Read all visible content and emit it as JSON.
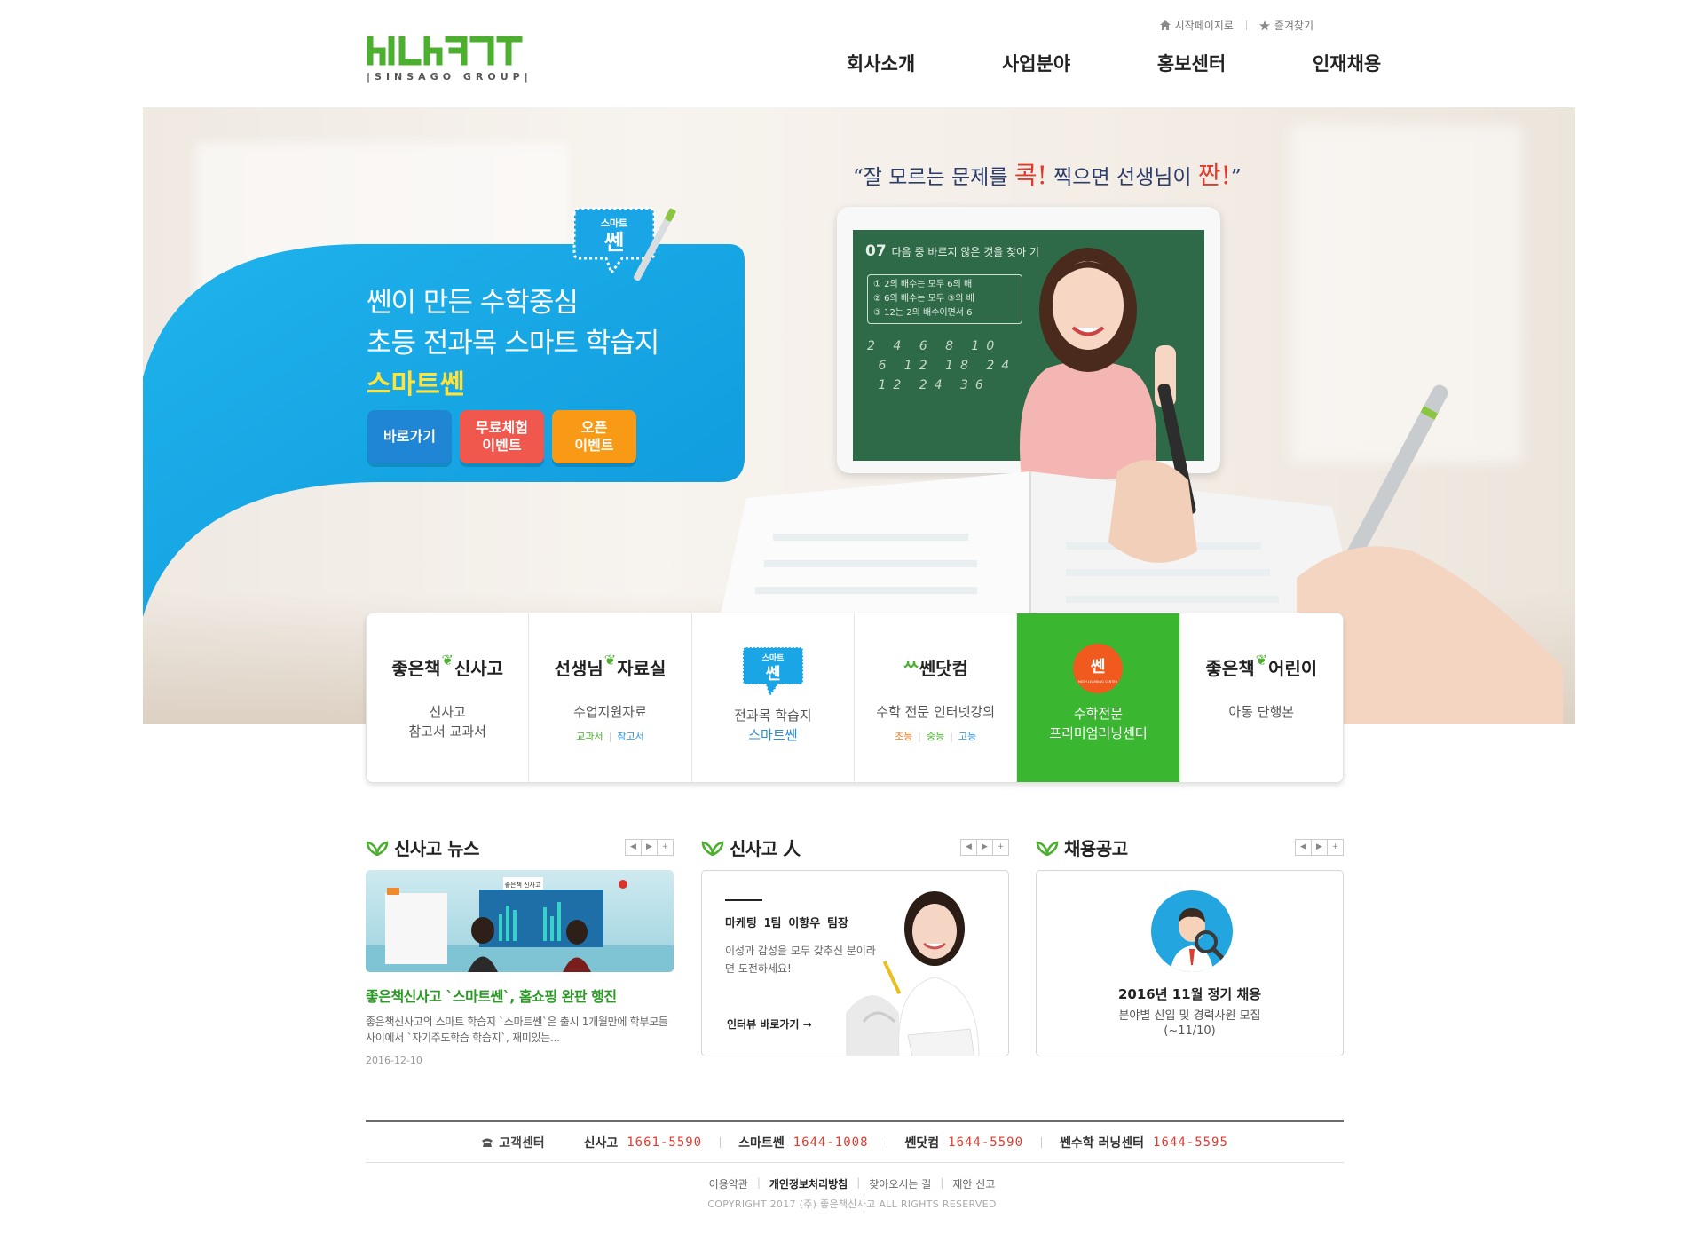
{
  "header": {
    "logo_mark": "hILhHTI",
    "logo_sub": "|SINSAGO GROUP|",
    "util": {
      "start_label": "시작페이지로",
      "fav_label": "즐겨찾기"
    },
    "nav": [
      "회사소개",
      "사업분야",
      "홍보센터",
      "인재채용"
    ]
  },
  "hero": {
    "quote_pre": "“잘 모르는 문제를 ",
    "quote_hl1": "콕!",
    "quote_mid": " 찍으면 선생님이 ",
    "quote_hl2": "짠!",
    "quote_post": "”",
    "badge_top": "스마트",
    "badge_main": "쎈",
    "line1": "쎈이 만든 수학중심",
    "line2": "초등 전과목 스마트 학습지",
    "line3": "스마트쎈",
    "buttons": [
      "바로가기",
      "무료체험\n이벤트",
      "오픈\n이벤트"
    ],
    "tablet_qno": "07",
    "tablet_question": "다음 중 바르지 않은 것을 찾아 기",
    "tablet_options": [
      "① 2의 배수는 모두 6의 배",
      "② 6의 배수는 모두 ③의 배",
      "③ 12는 2의 배수이면서 6"
    ],
    "tablet_scribble": "2 4 6 8 10 \n 6 12 18 24 \n 12 24 36"
  },
  "cards": [
    {
      "pre": "좋은책",
      "post": "신사고",
      "desc": "신사고\n참고서 교과서",
      "links": []
    },
    {
      "pre": "선생님",
      "post": "자료실",
      "desc": "수업지원자료",
      "links": [
        {
          "t": "교과서",
          "c": "lg"
        },
        {
          "t": "참고서",
          "c": "lb"
        }
      ]
    },
    {
      "pre": "",
      "post": "",
      "badge": "쎈",
      "badge_top": "스마트",
      "desc": "전과목 학습지",
      "desc_hl": "스마트쎈",
      "links": []
    },
    {
      "pre": "",
      "post": "",
      "brand": "쎈닷컴",
      "desc": "수학 전문 인터넷강의",
      "links": [
        {
          "t": "초등",
          "c": "lo"
        },
        {
          "t": "중등",
          "c": "lg"
        },
        {
          "t": "고등",
          "c": "lb"
        }
      ]
    },
    {
      "pre": "",
      "post": "",
      "circle": "쎈",
      "circle_sub": "MATH LEARNING CENTER",
      "desc": "수학전문\n프리미엄러닝센터",
      "active": true,
      "links": []
    },
    {
      "pre": "좋은책",
      "post": "어린이",
      "desc": "아동 단행본",
      "links": []
    }
  ],
  "sections": {
    "news": {
      "title": "신사고 뉴스",
      "thumb_caption": "좋은책 신사고",
      "headline": "좋은책신사고 `스마트쎈`, 홈쇼핑 완판 행진",
      "body": "좋은책신사고의 스마트 학습지 `스마트쎈`은 출시 1개월만에 학부모들 사이에서 `자기주도학습 학습지`, 재미있는...",
      "date": "2016-12-10"
    },
    "people": {
      "title": "신사고 人",
      "name": "마케팅 1팀 이향우 팀장",
      "msg": "이성과 감성을 모두 갖추신 분이라면 도전하세요!",
      "more": "인터뷰 바로가기 →"
    },
    "recruit": {
      "title": "채용공고",
      "t1": "2016년 11월 정기 채용",
      "t2": "분야별 신입 및 경력사원 모집",
      "t3": "(~11/10)"
    }
  },
  "footer": {
    "cs_label": "고객센터",
    "contacts": [
      {
        "name": "신사고",
        "phone": "1661-5590"
      },
      {
        "name": "스마트쎈",
        "phone": "1644-1008"
      },
      {
        "name": "쎈닷컴",
        "phone": "1644-5590"
      },
      {
        "name": "쎈수학 러닝센터",
        "phone": "1644-5595"
      }
    ],
    "links": [
      "이용약관",
      "개인정보처리방침",
      "찾아오시는 길",
      "제안 신고"
    ],
    "copyright": "COPYRIGHT 2017 (주) 좋은책신사고 ALL RIGHTS RESERVED"
  },
  "colors": {
    "brand_green": "#4caf2f",
    "hero_blue": "#17a7e4",
    "accent_red": "#e23b2e",
    "active_card": "#3bb631"
  }
}
